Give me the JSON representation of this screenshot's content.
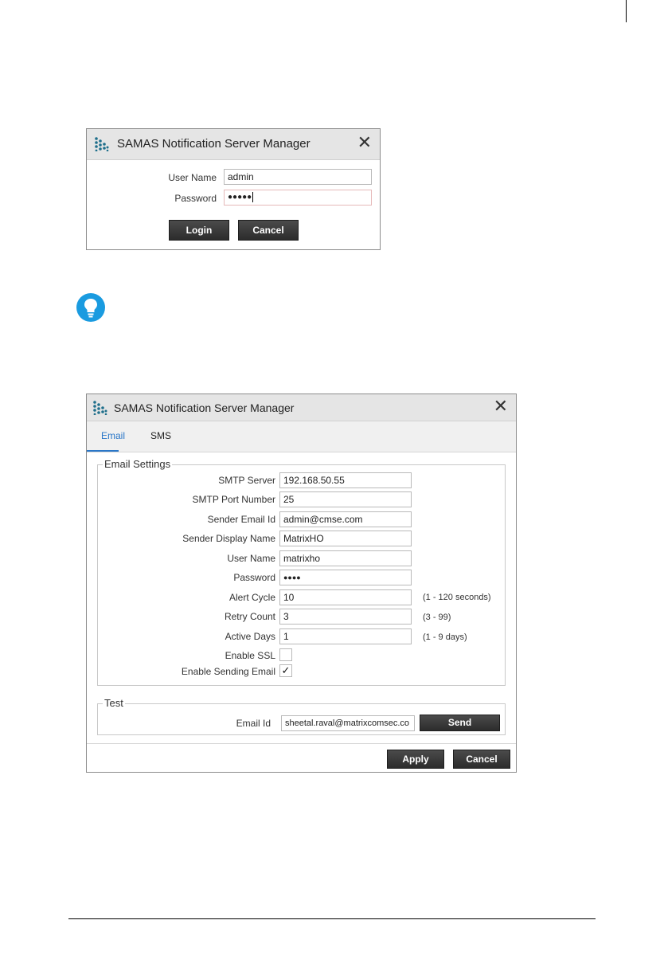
{
  "login_dialog": {
    "title": "SAMAS Notification Server Manager",
    "close_glyph": "✕",
    "username_label": "User Name",
    "username_value": "admin",
    "password_label": "Password",
    "password_value": "●●●●●",
    "login_label": "Login",
    "cancel_label": "Cancel"
  },
  "tip": {
    "icon": "lightbulb-icon",
    "color": "#1a9be0"
  },
  "settings_dialog": {
    "title": "SAMAS Notification Server Manager",
    "close_glyph": "✕",
    "tabs": [
      {
        "label": "Email",
        "active": true
      },
      {
        "label": "SMS",
        "active": false
      }
    ],
    "email_settings": {
      "group_title": "Email Settings",
      "fields": [
        {
          "label": "SMTP Server",
          "value": "192.168.50.55",
          "hint": ""
        },
        {
          "label": "SMTP Port Number",
          "value": "25",
          "hint": ""
        },
        {
          "label": "Sender Email Id",
          "value": "admin@cmse.com",
          "hint": ""
        },
        {
          "label": "Sender Display Name",
          "value": "MatrixHO",
          "hint": ""
        },
        {
          "label": "User Name",
          "value": "matrixho",
          "hint": ""
        },
        {
          "label": "Password",
          "value": "●●●●",
          "hint": ""
        },
        {
          "label": "Alert Cycle",
          "value": "10",
          "hint": "(1 - 120 seconds)"
        },
        {
          "label": "Retry Count",
          "value": "3",
          "hint": "(3 - 99)"
        },
        {
          "label": "Active Days",
          "value": "1",
          "hint": "(1 - 9 days)"
        }
      ],
      "enable_ssl_label": "Enable SSL",
      "enable_ssl_checked": false,
      "enable_sending_label": "Enable Sending Email",
      "enable_sending_checked": true,
      "check_glyph": "✓"
    },
    "test": {
      "group_title": "Test",
      "email_label": "Email Id",
      "email_value": "sheetal.raval@matrixcomsec.co",
      "send_label": "Send"
    },
    "apply_label": "Apply",
    "cancel_label": "Cancel"
  },
  "colors": {
    "accent": "#2a77c8",
    "logo": "#1f6f8b",
    "button_dark": "#333333"
  }
}
